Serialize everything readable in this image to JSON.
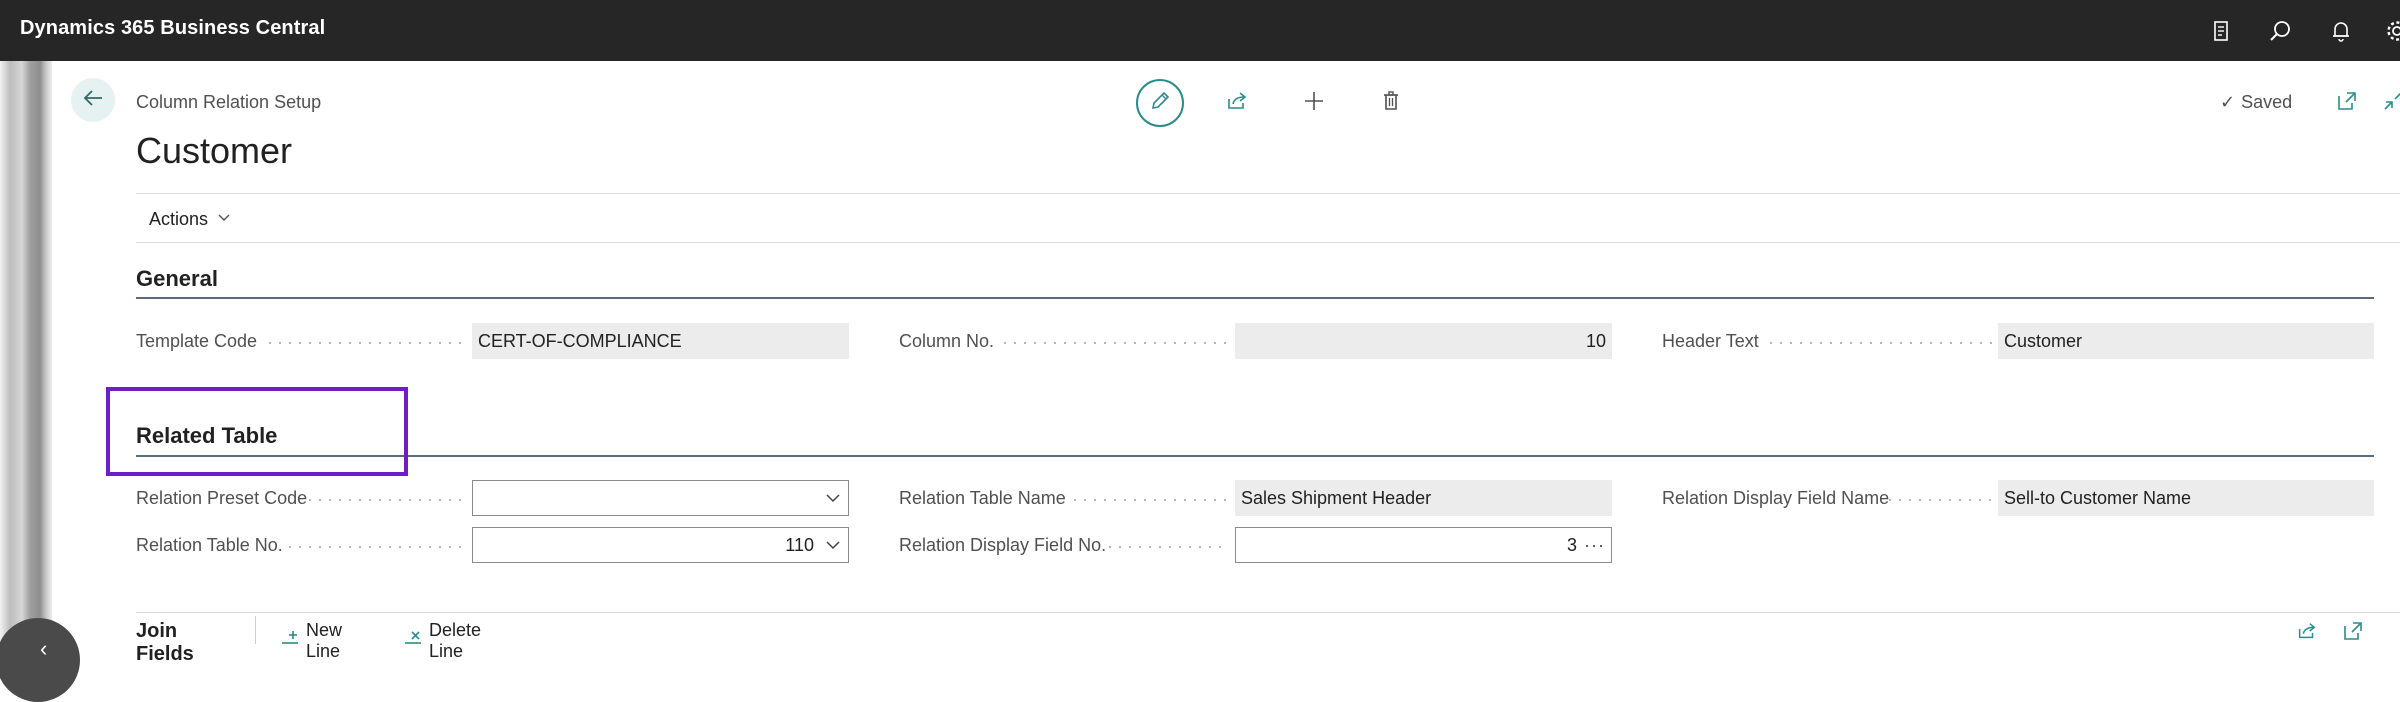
{
  "app": {
    "title": "Dynamics 365 Business Central"
  },
  "page": {
    "breadcrumb": "Column Relation Setup",
    "title": "Customer",
    "status": "Saved"
  },
  "actions_menu": {
    "label": "Actions"
  },
  "sections": {
    "general": {
      "title": "General",
      "fields": {
        "template_code": {
          "label": "Template Code",
          "value": "CERT-OF-COMPLIANCE"
        },
        "column_no": {
          "label": "Column No.",
          "value": "10"
        },
        "header_text": {
          "label": "Header Text",
          "value": "Customer"
        }
      }
    },
    "related_table": {
      "title": "Related Table",
      "fields": {
        "relation_preset_code": {
          "label": "Relation Preset Code",
          "value": ""
        },
        "relation_table_no": {
          "label": "Relation Table No.",
          "value": "110"
        },
        "relation_table_name": {
          "label": "Relation Table Name",
          "value": "Sales Shipment Header"
        },
        "relation_display_field_no": {
          "label": "Relation Display Field No.",
          "value": "3"
        },
        "relation_display_field_name": {
          "label": "Relation Display Field Name",
          "value": "Sell-to Customer Name"
        }
      }
    }
  },
  "join_fields": {
    "title": "Join Fields",
    "new_line": "New Line",
    "delete_line": "Delete Line"
  },
  "colors": {
    "app_bar": "#262626",
    "accent": "#2c8b8b",
    "highlight": "#6f1dc5",
    "readonly_field": "#ececec"
  },
  "icons": [
    "document-icon",
    "search-icon",
    "bell-icon",
    "gear-icon",
    "back-arrow-icon",
    "edit-pencil-icon",
    "share-icon",
    "add-icon",
    "delete-icon",
    "check-icon",
    "open-new-window-icon",
    "collapse-icon",
    "chevron-down-icon",
    "ellipsis-icon",
    "new-line-icon",
    "delete-line-icon"
  ]
}
